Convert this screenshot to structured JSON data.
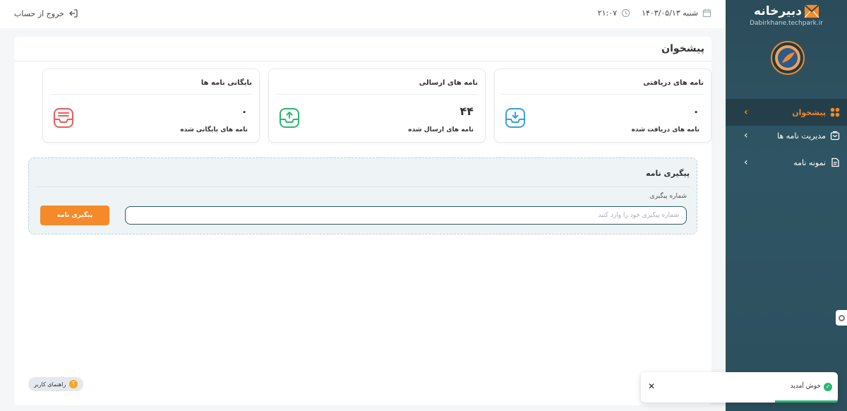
{
  "topbar": {
    "logout_label": "خروج از حساب",
    "date": "شنبه ۱۴۰۳/۰۵/۱۳",
    "time": "۲۱:۰۷"
  },
  "sidebar": {
    "brand_name": "دبیرخانه",
    "brand_domain": "Dabirkhane.techpark.ir",
    "items": [
      {
        "label": "پیشخوان",
        "icon": "dashboard-grid-icon",
        "active": true
      },
      {
        "label": "مدیریت نامه ها",
        "icon": "letters-icon",
        "active": false
      },
      {
        "label": "نمونه نامه",
        "icon": "template-icon",
        "active": false
      }
    ]
  },
  "main": {
    "title": "پیشخوان",
    "stats": [
      {
        "title": "نامه های دریافتی",
        "count": "۰",
        "label": "نامه های دریافت شده",
        "icon": "inbox-down-icon",
        "color": "#3aa0d8"
      },
      {
        "title": "نامه های ارسالی",
        "count": "۴۴",
        "label": "نامه های ارسال شده",
        "icon": "outbox-up-icon",
        "color": "#2bb673"
      },
      {
        "title": "بایگانی نامه ها",
        "count": "۰",
        "label": "نامه های بایگانی شده",
        "icon": "archive-icon",
        "color": "#e85c5c"
      }
    ],
    "tracking": {
      "title": "پیگیری نامه",
      "field_label": "شماره پیگیری",
      "placeholder": "شماره پیگیری خود را وارد کنید",
      "value": "",
      "button_label": "پیگیری نامه"
    }
  },
  "guide": {
    "label": "راهنمای کاربر",
    "badge": "؟"
  },
  "toast": {
    "message": "خوش آمدید",
    "close": "✕"
  },
  "colors": {
    "sidebar_bg": "#2b4c5a",
    "accent": "#f58a2a",
    "success": "#2bb673"
  }
}
